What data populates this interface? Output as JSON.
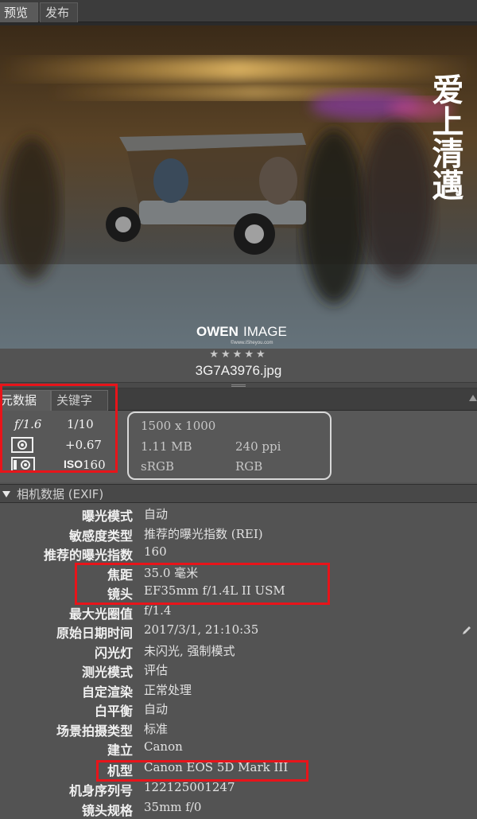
{
  "top_tabs": [
    {
      "label": "预览"
    },
    {
      "label": "发布"
    }
  ],
  "photo": {
    "watermark_vertical": "爱上清邁",
    "watermark_brand": "OWEN",
    "watermark_image": "IMAGE",
    "watermark_url": "©www.iSheyou.com"
  },
  "rating": "★★★★★",
  "filename": "3G7A3976.jpg",
  "panel_tabs": [
    {
      "label": "元数据"
    },
    {
      "label": "关键字"
    }
  ],
  "quick": {
    "aperture": "f/1.6",
    "shutter": "1/10",
    "exposure_comp": "+0.67",
    "iso_label": "ISO",
    "iso_value": "160",
    "dimensions": "1500 x 1000",
    "file_size": "1.11 MB",
    "resolution": "240 ppi",
    "color_profile": "sRGB",
    "color_mode": "RGB"
  },
  "section": {
    "title": "相机数据 (EXIF)"
  },
  "exif": [
    {
      "label": "曝光模式",
      "value": "自动"
    },
    {
      "label": "敏感度类型",
      "value": "推荐的曝光指数 (REI)"
    },
    {
      "label": "推荐的曝光指数",
      "value": "160"
    },
    {
      "label": "焦距",
      "value": "35.0 毫米"
    },
    {
      "label": "镜头",
      "value": "EF35mm f/1.4L II USM"
    },
    {
      "label": "最大光圈值",
      "value": "f/1.4"
    },
    {
      "label": "原始日期时间",
      "value": "2017/3/1, 21:10:35"
    },
    {
      "label": "闪光灯",
      "value": "未闪光, 强制模式"
    },
    {
      "label": "测光模式",
      "value": "评估"
    },
    {
      "label": "自定渲染",
      "value": "正常处理"
    },
    {
      "label": "白平衡",
      "value": "自动"
    },
    {
      "label": "场景拍摄类型",
      "value": "标准"
    },
    {
      "label": "建立",
      "value": "Canon"
    },
    {
      "label": "机型",
      "value": "Canon EOS 5D Mark III"
    },
    {
      "label": "机身序列号",
      "value": "122125001247"
    },
    {
      "label": "镜头规格",
      "value": "35mm f/0"
    }
  ],
  "colors": {
    "highlight_red": "#e8141a",
    "panel_bg": "#535353"
  },
  "icons": [
    "aperture-icon",
    "shutter-icon",
    "metering-icon",
    "exposure-mode-icon",
    "pencil-icon"
  ]
}
